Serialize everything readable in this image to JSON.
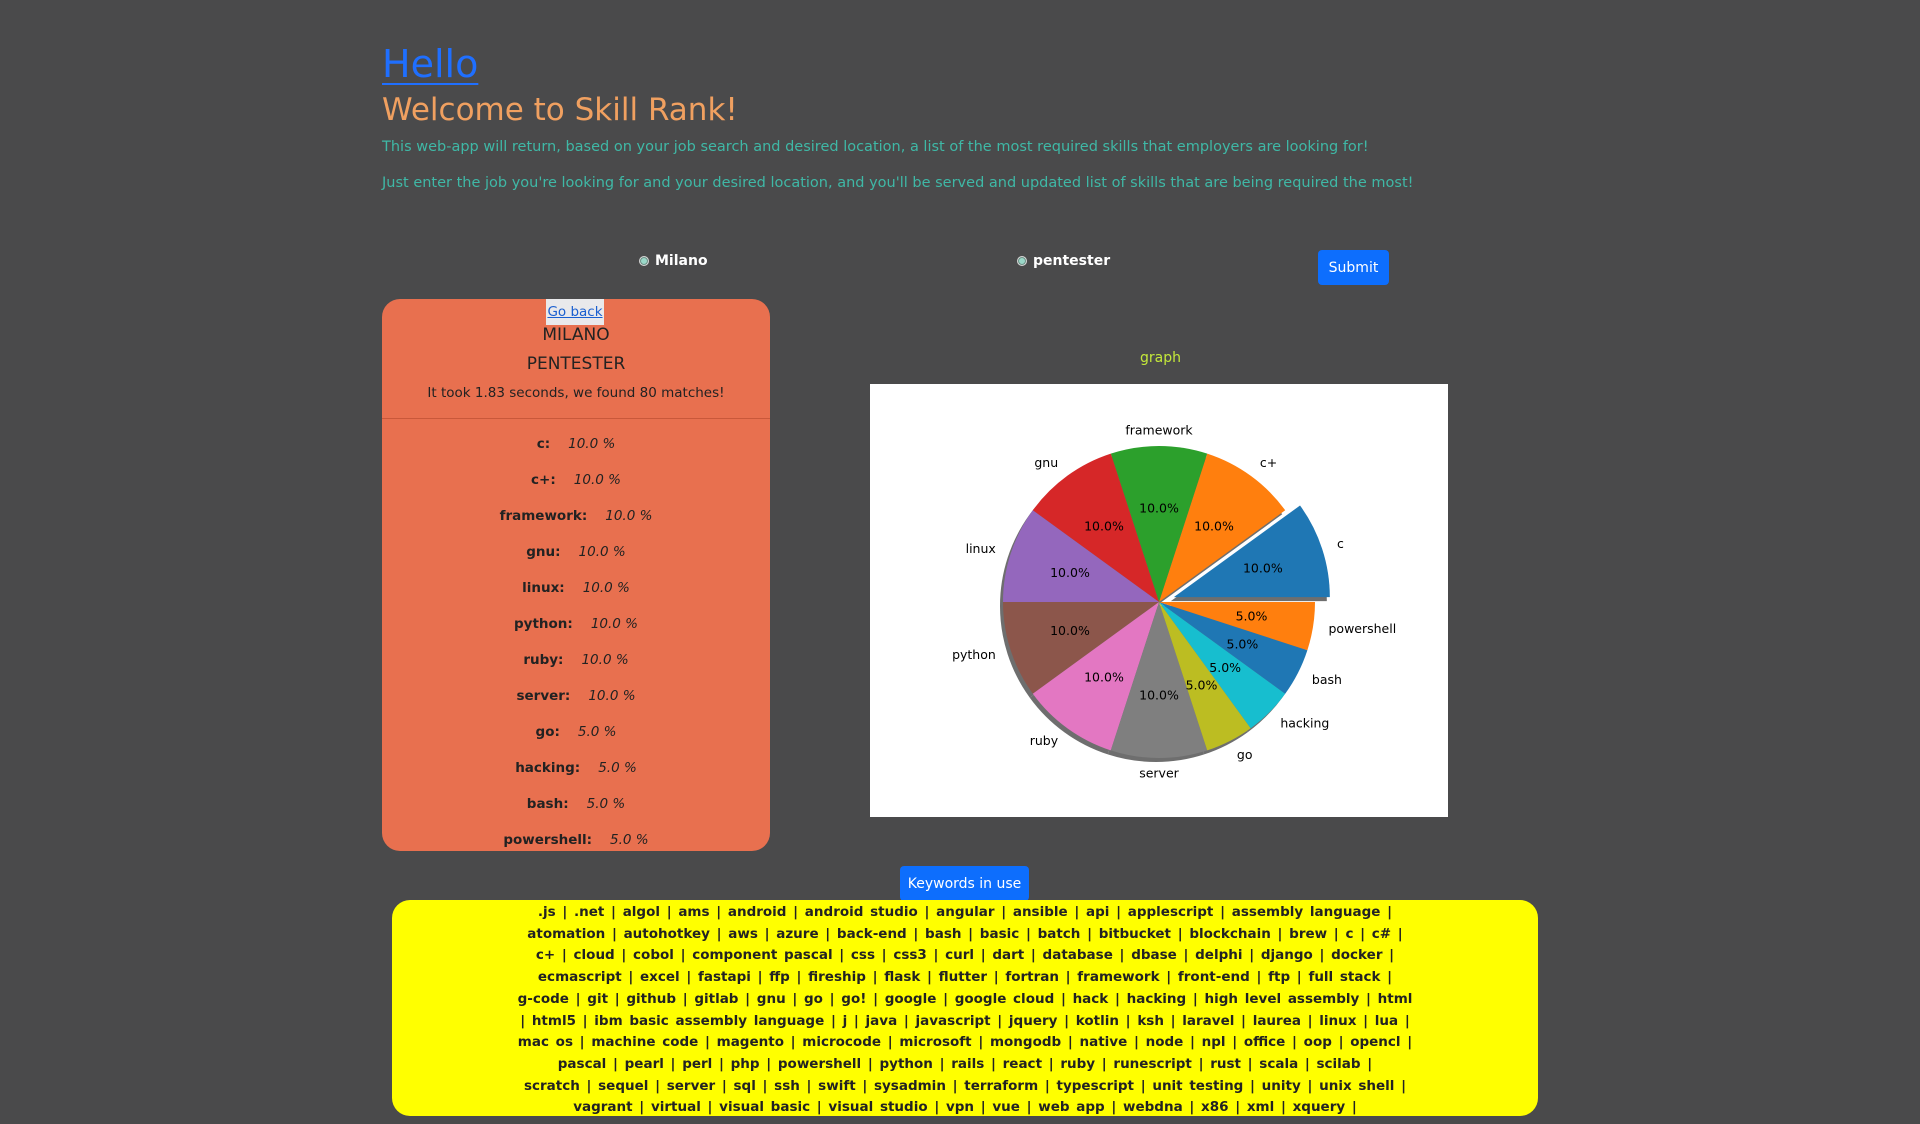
{
  "header": {
    "hello": "Hello",
    "welcome": "Welcome to Skill Rank!",
    "intro_1": "This web-app will return, based on your job search and desired location, a list of the most required skills that employers are looking for!",
    "intro_2": "Just enter the job you're looking for and your desired location, and you'll be served and updated list of skills that are being required the most!"
  },
  "form": {
    "location_value": "Milano",
    "job_value": "pentester",
    "submit_label": "Submit"
  },
  "results": {
    "go_back": "Go back",
    "city": "MILANO",
    "job": "PENTESTER",
    "time_text": "It took 1.83 seconds, we found 80 matches!",
    "skills": [
      {
        "name": "c:",
        "value": "10.0 %"
      },
      {
        "name": "c+:",
        "value": "10.0 %"
      },
      {
        "name": "framework:",
        "value": "10.0 %"
      },
      {
        "name": "gnu:",
        "value": "10.0 %"
      },
      {
        "name": "linux:",
        "value": "10.0 %"
      },
      {
        "name": "python:",
        "value": "10.0 %"
      },
      {
        "name": "ruby:",
        "value": "10.0 %"
      },
      {
        "name": "server:",
        "value": "10.0 %"
      },
      {
        "name": "go:",
        "value": "5.0 %"
      },
      {
        "name": "hacking:",
        "value": "5.0 %"
      },
      {
        "name": "bash:",
        "value": "5.0 %"
      },
      {
        "name": "powershell:",
        "value": "5.0 %"
      }
    ]
  },
  "graph": {
    "label": "graph"
  },
  "chart_data": {
    "type": "pie",
    "categories": [
      "c",
      "c+",
      "framework",
      "gnu",
      "linux",
      "python",
      "ruby",
      "server",
      "go",
      "hacking",
      "bash",
      "powershell"
    ],
    "values": [
      10.0,
      10.0,
      10.0,
      10.0,
      10.0,
      10.0,
      10.0,
      10.0,
      5.0,
      5.0,
      5.0,
      5.0
    ],
    "pct_labels": [
      "10.0%",
      "10.0%",
      "10.0%",
      "10.0%",
      "10.0%",
      "10.0%",
      "10.0%",
      "10.0%",
      "5.0%",
      "5.0%",
      "5.0%",
      "5.0%"
    ],
    "colors": [
      "#1f77b4",
      "#ff7f0e",
      "#2ca02c",
      "#d62728",
      "#9467bd",
      "#8c564b",
      "#e377c2",
      "#7f7f7f",
      "#bcbd22",
      "#17becf",
      "#1f77b4",
      "#ff7f0e"
    ],
    "explode": [
      0.1,
      0,
      0,
      0,
      0,
      0,
      0,
      0,
      0,
      0,
      0,
      0
    ],
    "shadow": true,
    "start_angle": 0,
    "title": ""
  },
  "keywords": {
    "button_label": "Keywords in use",
    "lines": [
      ".js   |   .net   |   algol   |   ams   |   android   |   android studio   |   angular   |   ansible   |   api   |   applescript   |   assembly language   |",
      "atomation   |   autohotkey   |   aws   |   azure   |   back-end   |   bash   |   basic   |   batch   |   bitbucket   |   blockchain   |   brew   |   c   |   c#   |",
      "c+   |   cloud   |   cobol   |   component pascal   |   css   |   css3   |   curl   |   dart   |   database   |   dbase   |   delphi   |   django   |   docker   |",
      "ecmascript   |   excel   |   fastapi   |   ffp   |   fireship   |   flask   |   flutter   |   fortran   |   framework   |   front-end   |   ftp   |   full stack   |",
      "g-code   |   git   |   github   |   gitlab   |   gnu   |   go   |   go!   |   google   |   google cloud   |   hack   |   hacking   |   high level assembly   |   html",
      "|   html5   |   ibm basic assembly language   |   j   |   java   |   javascript   |   jquery   |   kotlin   |   ksh   |   laravel   |   laurea   |   linux   |   lua   |",
      "mac os   |   machine code   |   magento   |   microcode   |   microsoft   |   mongodb   |   native   |   node   |   npl   |   office   |   oop   |   opencl   |",
      "pascal   |   pearl   |   perl   |   php   |   powershell   |   python   |   rails   |   react   |   ruby   |   runescript   |   rust   |   scala   |   scilab   |",
      "scratch   |   sequel   |   server   |   sql   |   ssh   |   swift   |   sysadmin   |   terraform   |   typescript   |   unit testing   |   unity   |   unix shell   |",
      "vagrant   |   virtual   |   visual basic   |   visual studio   |   vpn   |   vue   |   web app   |   webdna   |   x86   |   xml   |   xquery   |"
    ]
  }
}
